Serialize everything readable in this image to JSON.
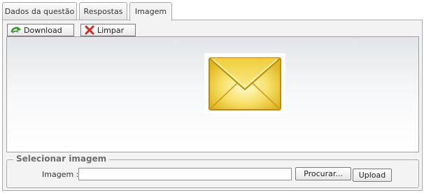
{
  "tabs": [
    {
      "label": "Dados da questão",
      "active": false
    },
    {
      "label": "Respostas",
      "active": false
    },
    {
      "label": "Imagem",
      "active": true
    }
  ],
  "toolbar": {
    "download_label": "Download",
    "download_icon": "download-arrow-icon",
    "clear_label": "Limpar",
    "clear_icon": "red-x-icon"
  },
  "image_preview": {
    "icon": "envelope-icon"
  },
  "select_image": {
    "legend": "Selecionar imagem",
    "field_label": "Imagem :",
    "field_value": "",
    "browse_label": "Procurar...",
    "upload_label": "Upload"
  },
  "colors": {
    "panel_bg": "#f3f3f3",
    "border": "#a9a9a9",
    "envelope_yellow": "#f5d94a",
    "download_green": "#2e9a2e",
    "clear_red": "#d12b1f"
  }
}
